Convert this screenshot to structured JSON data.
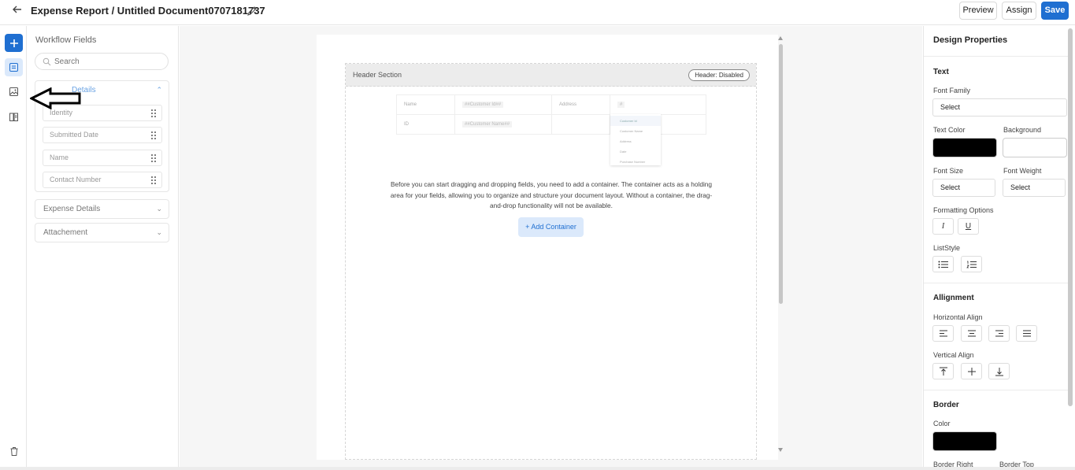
{
  "header": {
    "title": "Expense Report / Untitled Document0707181737",
    "buttons": {
      "preview": "Preview",
      "assign": "Assign",
      "save": "Save"
    }
  },
  "rail": {
    "icons": [
      "plus-icon",
      "form-icon",
      "image-icon",
      "document-icon",
      "trash-icon"
    ]
  },
  "fields_panel": {
    "title": "Workflow Fields",
    "search_placeholder": "Search",
    "groups": [
      {
        "label": "Customer Details",
        "label_visible": "Details",
        "expanded": true,
        "items": [
          "Identity",
          "Submitted Date",
          "Name",
          "Contact Number"
        ]
      },
      {
        "label": "Expense Details",
        "expanded": false
      },
      {
        "label": "Attachement",
        "expanded": false
      }
    ]
  },
  "canvas": {
    "header_section_label": "Header Section",
    "header_status": "Header: Disabled",
    "preview_table": {
      "rows": [
        [
          "Name",
          "##Customer Id##",
          "Address",
          "#"
        ],
        [
          "ID",
          "##Customer Name##",
          "",
          ""
        ]
      ]
    },
    "dropdown_options": [
      "Customer Id",
      "Customer Name",
      "Address",
      "Date",
      "Purchase Number"
    ],
    "help_text": "Before you can start dragging and dropping fields, you need to add a container. The container acts as a holding area for your fields, allowing you to organize and structure your document layout. Without a container, the drag-and-drop functionality will not be available.",
    "add_container_label": "+ Add Container"
  },
  "design_properties": {
    "title": "Design Properties",
    "text_section": {
      "title": "Text",
      "font_family_label": "Font Family",
      "font_family_value": "Select",
      "text_color_label": "Text Color",
      "text_color": "#000000",
      "background_label": "Background",
      "background_color": "#ffffff",
      "font_size_label": "Font Size",
      "font_size_value": "Select",
      "font_weight_label": "Font Weight",
      "font_weight_value": "Select",
      "formatting_label": "Formatting Options",
      "formatting_buttons": [
        "I",
        "U"
      ],
      "liststyle_label": "ListStyle"
    },
    "alignment_section": {
      "title": "Allignment",
      "horizontal_label": "Horizontal Align",
      "vertical_label": "Vertical Align"
    },
    "border_section": {
      "title": "Border",
      "color_label": "Color",
      "color": "#000000",
      "border_right_label": "Border Right",
      "border_top_label": "Border Top"
    }
  },
  "colors": {
    "accent": "#1f6fd1",
    "accent_light": "#dbe9fb"
  }
}
